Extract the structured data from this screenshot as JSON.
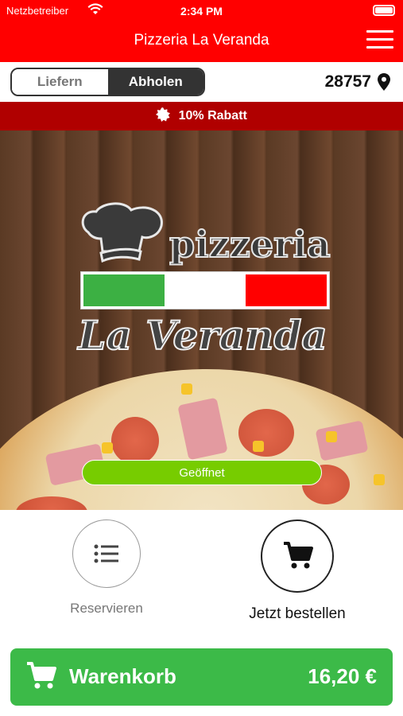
{
  "status_bar": {
    "carrier": "Netzbetreiber",
    "time": "2:34 PM"
  },
  "header": {
    "title": "Pizzeria La Veranda"
  },
  "mode_toggle": {
    "options": [
      {
        "label": "Liefern",
        "selected": false
      },
      {
        "label": "Abholen",
        "selected": true
      }
    ]
  },
  "location": {
    "zip": "28757"
  },
  "promo": {
    "text": "10% Rabatt"
  },
  "logo": {
    "word": "pizzeria",
    "name": "La Veranda",
    "flag_colors": [
      "#3cb043",
      "#ffffff",
      "#ff0000"
    ]
  },
  "store_status": {
    "label": "Geöffnet",
    "color": "#77cc00"
  },
  "actions": {
    "reserve_label": "Reservieren",
    "order_label": "Jetzt bestellen"
  },
  "cart": {
    "label": "Warenkorb",
    "total": "16,20 €"
  },
  "colors": {
    "brand_red": "#ff0000",
    "promo_red": "#b00000",
    "cart_green": "#3cba48"
  },
  "icons": [
    "wifi-icon",
    "battery-icon",
    "menu-icon",
    "location-pin-icon",
    "badge-star-icon",
    "chef-hat-icon",
    "list-icon",
    "cart-icon"
  ]
}
